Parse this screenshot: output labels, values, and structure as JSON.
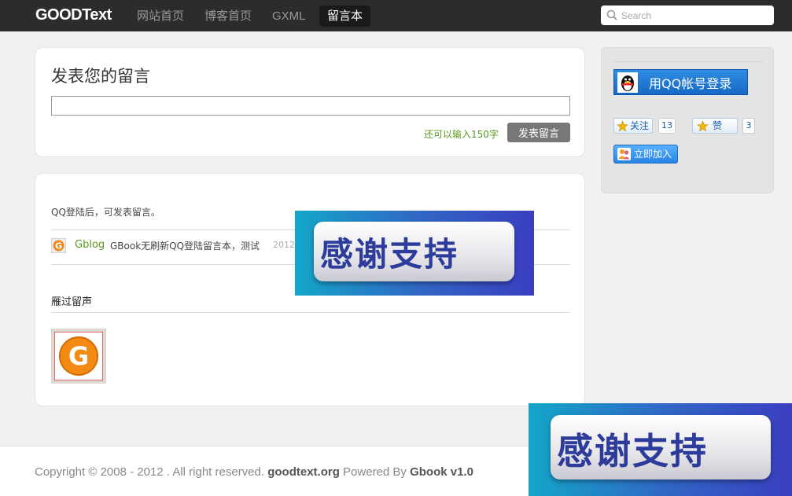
{
  "header": {
    "logo": "GOODText",
    "nav": [
      {
        "label": "网站首页"
      },
      {
        "label": "博客首页"
      },
      {
        "label": "GXML"
      },
      {
        "label": "留言本"
      }
    ],
    "active_nav": "留言本",
    "search": {
      "placeholder": "Search"
    }
  },
  "post_form": {
    "title": "发表您的留言",
    "input_value": "",
    "remaining": "还可以输入150字",
    "submit_label": "发表留言"
  },
  "messages": {
    "login_tip": "QQ登陆后，可发表留言。",
    "items": [
      {
        "user": "Gblog",
        "text": "GBook无刷新QQ登陆留言本，测试",
        "time": "2012"
      }
    ]
  },
  "visitors": {
    "title": "雁过留声"
  },
  "sidebar": {
    "qq_login_label": "用QQ帐号登录",
    "follow": {
      "label": "关注",
      "count": "13"
    },
    "like": {
      "label": "赞",
      "count": "3"
    },
    "join_label": "立即加入"
  },
  "banner": {
    "text": "感谢支持"
  },
  "footer": {
    "copyright_prefix": "Copyright © 2008 - 2012 . All right reserved.",
    "site": "goodtext.org",
    "powered_prefix": "Powered By",
    "product": "Gbook v1.0"
  },
  "colors": {
    "topbar": "#2c2c2c",
    "accent_green": "#5a9a1e",
    "qq_blue": "#1769c6"
  }
}
